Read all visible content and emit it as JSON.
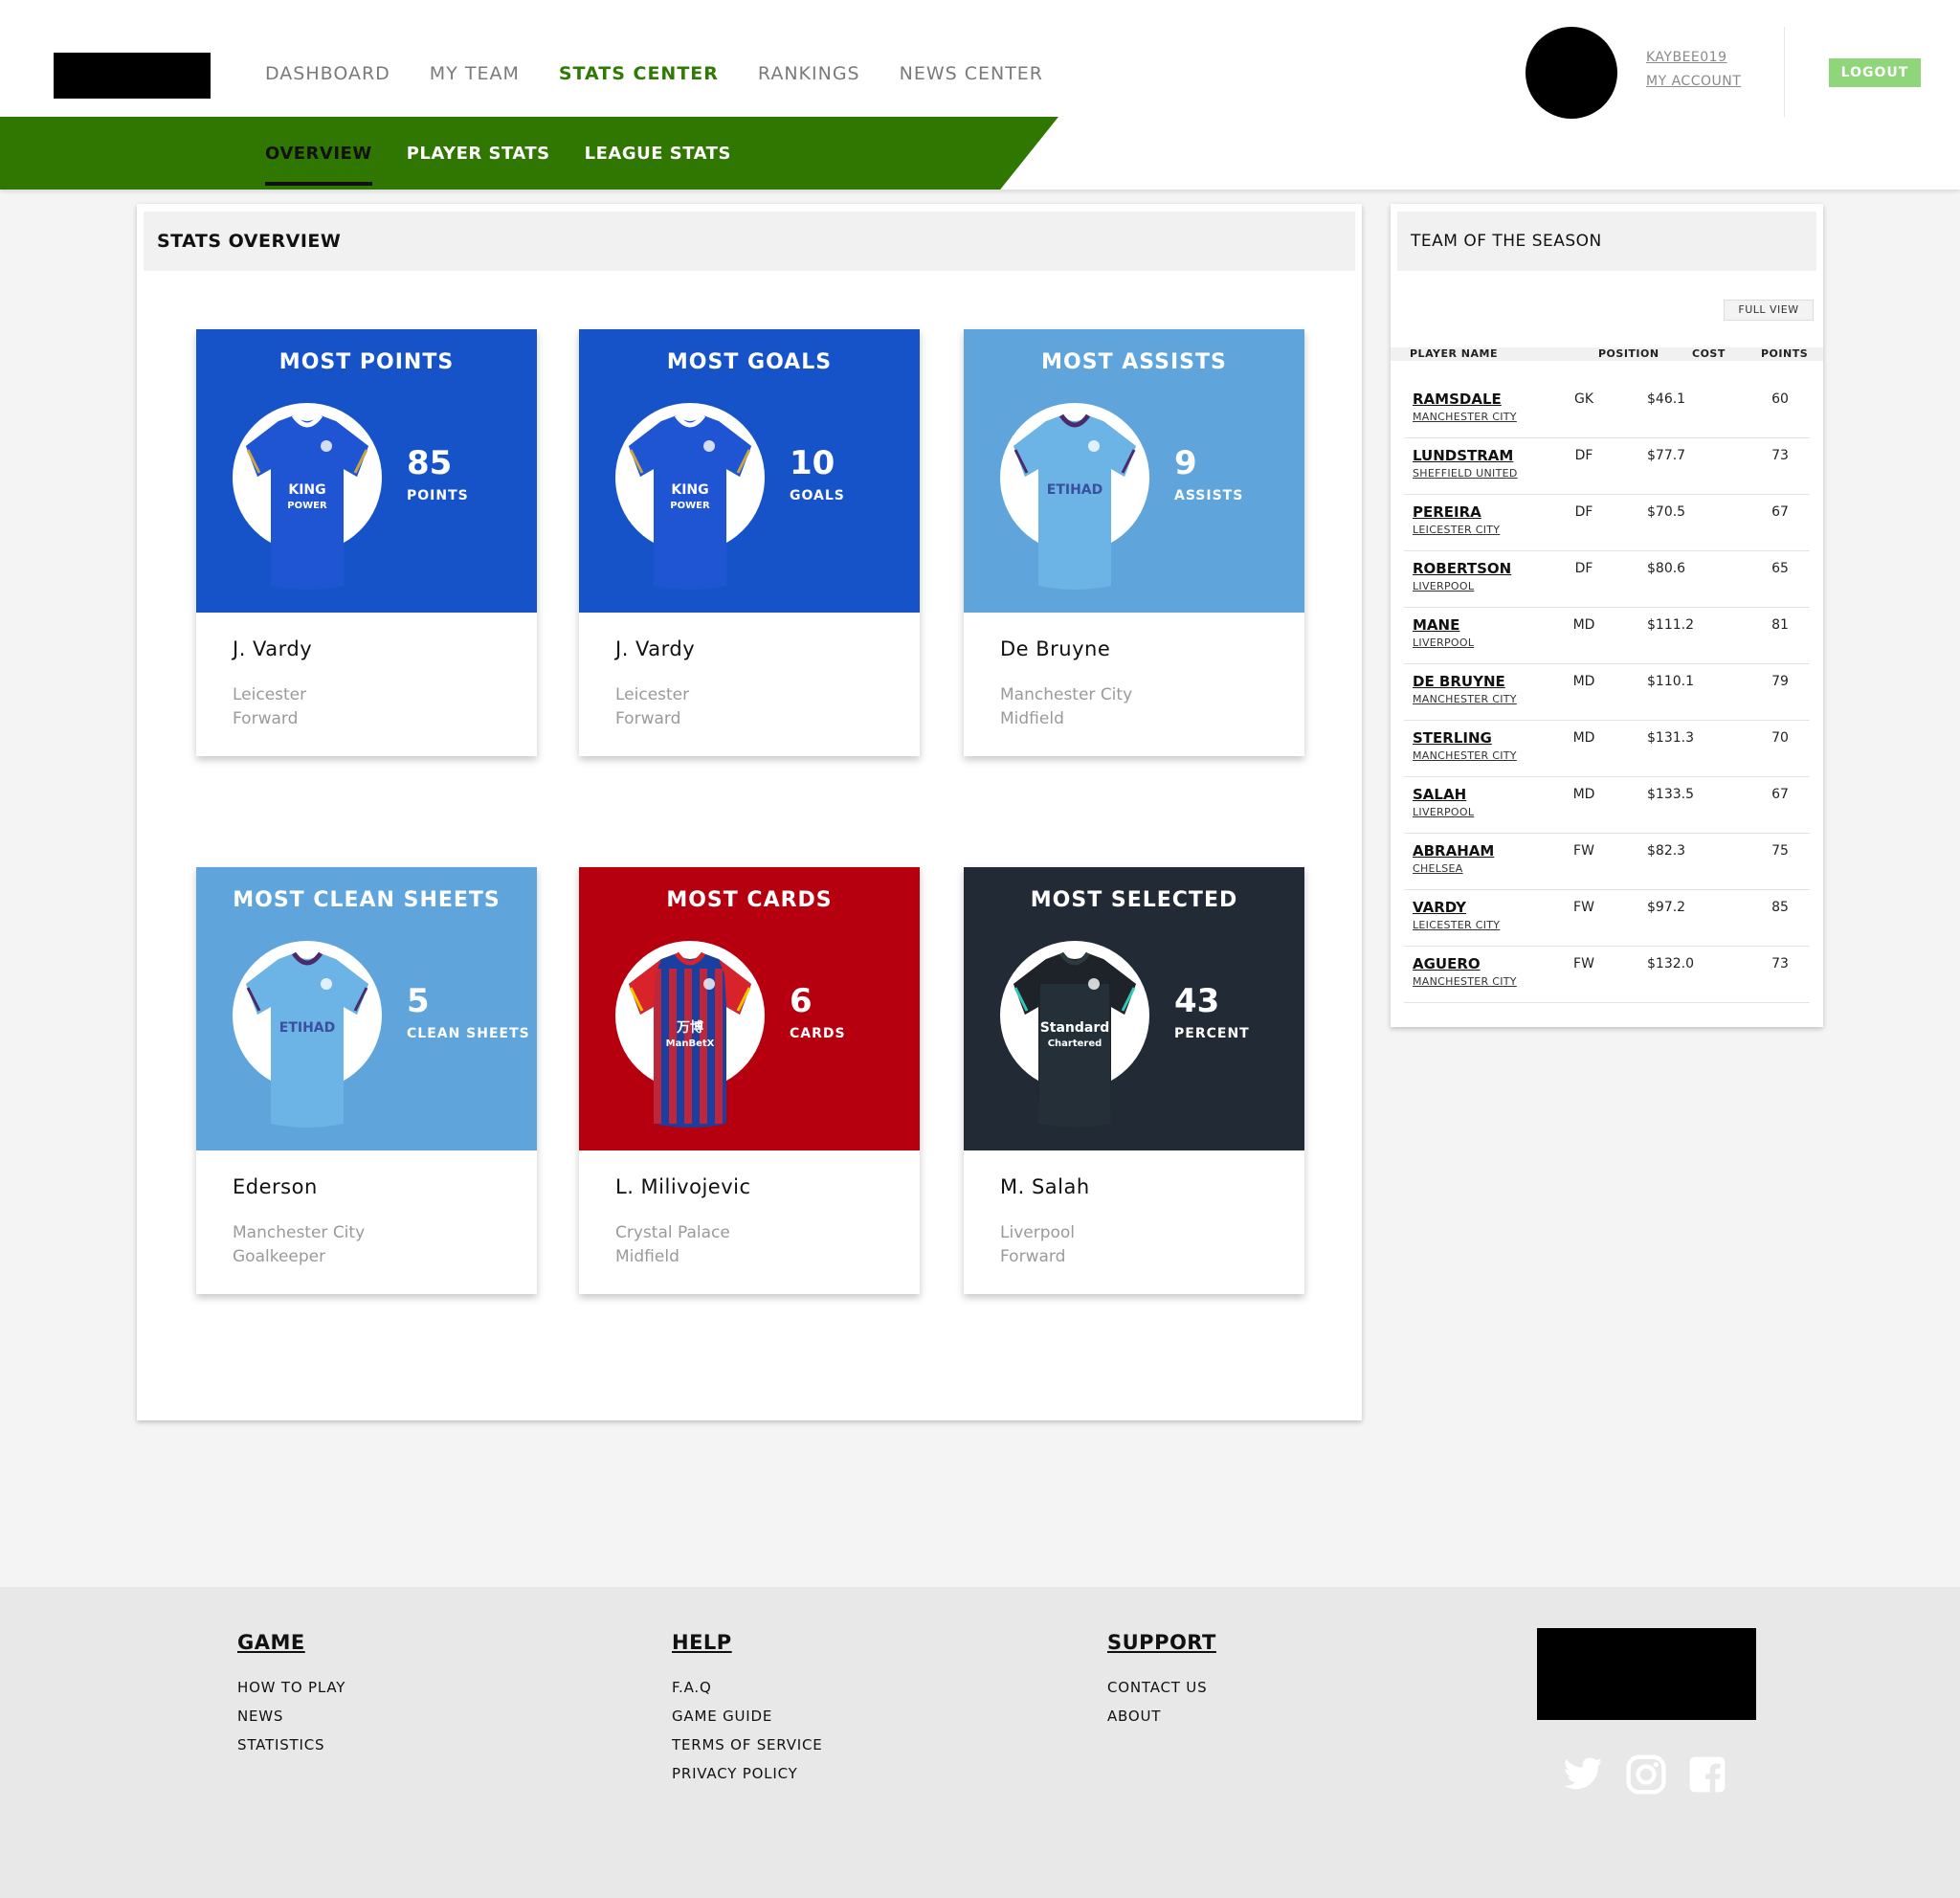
{
  "nav": {
    "items": [
      "DASHBOARD",
      "MY TEAM",
      "STATS CENTER",
      "RANKINGS",
      "NEWS CENTER"
    ],
    "active": "STATS CENTER"
  },
  "subnav": {
    "items": [
      "OVERVIEW",
      "PLAYER STATS",
      "LEAGUE STATS"
    ],
    "active": "OVERVIEW"
  },
  "user": {
    "username": "KAYBEE019",
    "account_label": "MY ACCOUNT",
    "logout_label": "LOGOUT"
  },
  "stats_overview": {
    "title": "STATS OVERVIEW",
    "cards": [
      {
        "title": "MOST POINTS",
        "value": "85",
        "unit": "POINTS",
        "player": "J. Vardy",
        "club": "Leicester",
        "position": "Forward",
        "bg": "#1753c8",
        "jersey": "leicester"
      },
      {
        "title": "MOST GOALS",
        "value": "10",
        "unit": "GOALS",
        "player": "J. Vardy",
        "club": "Leicester",
        "position": "Forward",
        "bg": "#1753c8",
        "jersey": "leicester"
      },
      {
        "title": "MOST ASSISTS",
        "value": "9",
        "unit": "ASSISTS",
        "player": "De Bruyne",
        "club": "Manchester City",
        "position": "Midfield",
        "bg": "#5fa5dc",
        "jersey": "mancity"
      },
      {
        "title": "MOST CLEAN SHEETS",
        "value": "5",
        "unit": "CLEAN SHEETS",
        "player": "Ederson",
        "club": "Manchester City",
        "position": "Goalkeeper",
        "bg": "#5fa5dc",
        "jersey": "mancity"
      },
      {
        "title": "MOST CARDS",
        "value": "6",
        "unit": "CARDS",
        "player": "L. Milivojevic",
        "club": "Crystal Palace",
        "position": "Midfield",
        "bg": "#b7000f",
        "jersey": "palace"
      },
      {
        "title": "MOST SELECTED",
        "value": "43",
        "unit": "PERCENT",
        "player": "M. Salah",
        "club": "Liverpool",
        "position": "Forward",
        "bg": "#222a36",
        "jersey": "liverpool"
      }
    ]
  },
  "team_of_season": {
    "title": "TEAM OF THE SEASON",
    "full_view_label": "FULL VIEW",
    "columns": [
      "PLAYER NAME",
      "POSITION",
      "COST",
      "POINTS"
    ],
    "rows": [
      {
        "name": "RAMSDALE",
        "club": "MANCHESTER CITY",
        "position": "GK",
        "cost": "$46.1",
        "points": "60"
      },
      {
        "name": "LUNDSTRAM",
        "club": "SHEFFIELD UNITED",
        "position": "DF",
        "cost": "$77.7",
        "points": "73"
      },
      {
        "name": "PEREIRA",
        "club": "LEICESTER CITY",
        "position": "DF",
        "cost": "$70.5",
        "points": "67"
      },
      {
        "name": "ROBERTSON",
        "club": "LIVERPOOL",
        "position": "DF",
        "cost": "$80.6",
        "points": "65"
      },
      {
        "name": "MANE",
        "club": "LIVERPOOL",
        "position": "MD",
        "cost": "$111.2",
        "points": "81"
      },
      {
        "name": "DE BRUYNE",
        "club": "MANCHESTER CITY",
        "position": "MD",
        "cost": "$110.1",
        "points": "79"
      },
      {
        "name": "STERLING",
        "club": "MANCHESTER CITY",
        "position": "MD",
        "cost": "$131.3",
        "points": "70"
      },
      {
        "name": "SALAH",
        "club": "LIVERPOOL",
        "position": "MD",
        "cost": "$133.5",
        "points": "67"
      },
      {
        "name": "ABRAHAM",
        "club": "CHELSEA",
        "position": "FW",
        "cost": "$82.3",
        "points": "75"
      },
      {
        "name": "VARDY",
        "club": "LEICESTER CITY",
        "position": "FW",
        "cost": "$97.2",
        "points": "85"
      },
      {
        "name": "AGUERO",
        "club": "MANCHESTER CITY",
        "position": "FW",
        "cost": "$132.0",
        "points": "73"
      }
    ]
  },
  "jersey_text": {
    "leicester": [
      "KING",
      "POWER"
    ],
    "mancity": [
      "ETIHAD"
    ],
    "palace": [
      "万博",
      "ManBetX"
    ],
    "liverpool": [
      "Standard",
      "Chartered"
    ]
  },
  "footer": {
    "columns": [
      {
        "heading": "GAME",
        "links": [
          "HOW TO PLAY",
          "NEWS",
          "STATISTICS"
        ]
      },
      {
        "heading": "HELP",
        "links": [
          "F.A.Q",
          "GAME GUIDE",
          "TERMS OF SERVICE",
          "PRIVACY POLICY"
        ]
      },
      {
        "heading": "SUPPORT",
        "links": [
          "CONTACT US",
          "ABOUT"
        ]
      }
    ],
    "social_icons": [
      "twitter-icon",
      "instagram-icon",
      "facebook-icon"
    ]
  },
  "colors": {
    "brand_green": "#2f7700",
    "active_nav": "#2f7a05",
    "logout_bg": "#8fd57a"
  }
}
